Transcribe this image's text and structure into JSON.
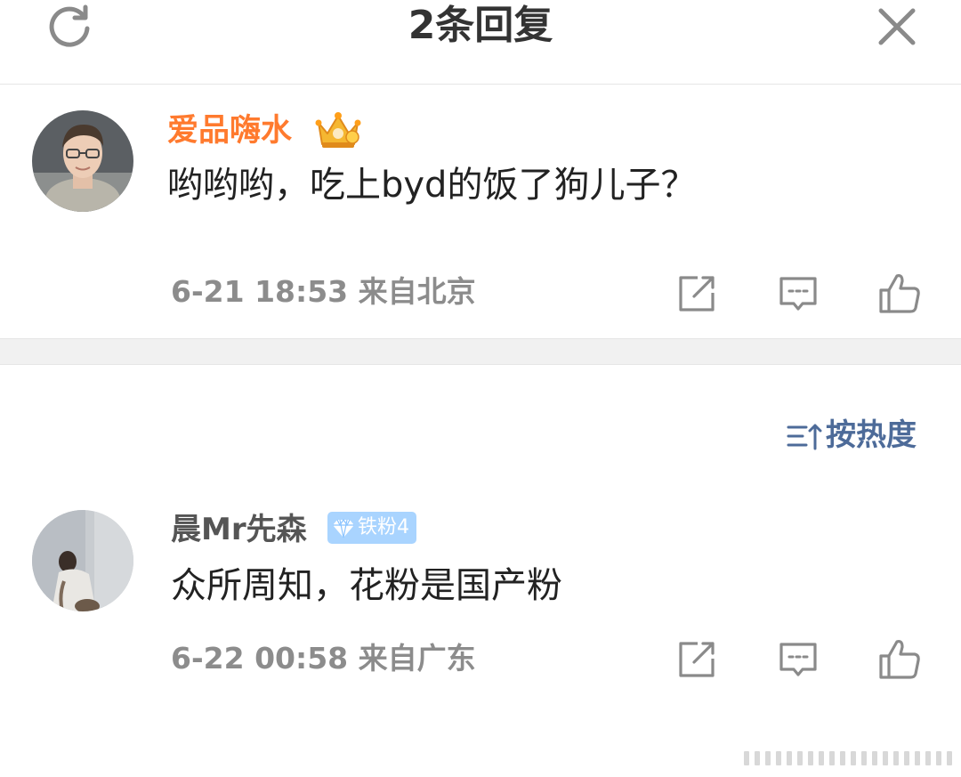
{
  "header": {
    "title": "2条回复",
    "refresh_icon": "refresh-icon",
    "close_icon": "close-icon"
  },
  "main_comment": {
    "username": "爱品嗨水",
    "badge_icon": "crown-icon",
    "username_color": "#ff7a2e",
    "text": "哟哟哟，吃上byd的饭了狗儿子？",
    "meta": "6-21 18:53  来自北京"
  },
  "sort": {
    "label": "按热度",
    "icon": "sort-icon"
  },
  "replies": [
    {
      "username": "晨Mr先森",
      "badge_label": "铁粉4",
      "badge_icon": "diamond-icon",
      "text": "众所周知，花粉是国产粉",
      "meta": "6-22 00:58  来自广东"
    }
  ],
  "actions": [
    "share-icon",
    "comment-icon",
    "like-icon"
  ],
  "colors": {
    "accent_orange": "#ff7a2e",
    "meta_gray": "#8c8c8c",
    "sort_blue": "#4d6b99",
    "badge_blue": "#a9d4ff"
  }
}
